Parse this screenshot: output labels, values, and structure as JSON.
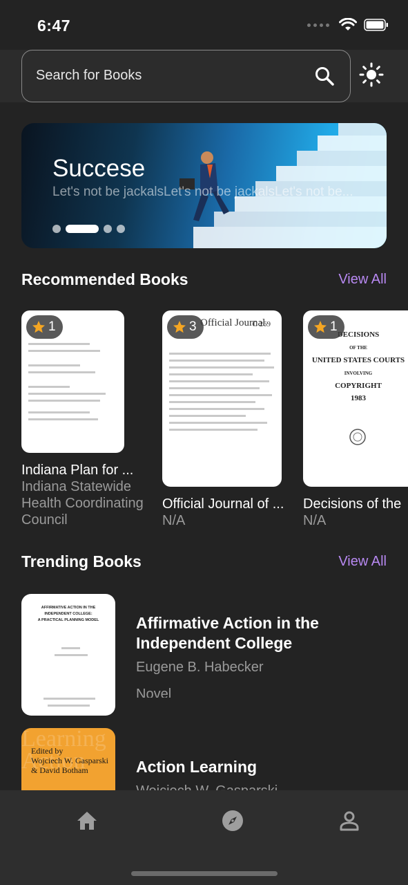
{
  "status_bar": {
    "time": "6:47"
  },
  "search": {
    "placeholder": "Search for Books"
  },
  "banner": {
    "title": "Succese",
    "subtitle": "Let's not be jackalsLet's not be jackalsLet's not be...",
    "pages": 4,
    "active_page": 1
  },
  "recommended": {
    "title": "Recommended Books",
    "view_all": "View All",
    "books": [
      {
        "rating": "1",
        "title": "Indiana Plan for ...",
        "author": "Indiana Statewide Health Coordinating Council"
      },
      {
        "rating": "3",
        "title": "Official Journal of ...",
        "author": "N/A",
        "cover_text": "Official Journal"
      },
      {
        "rating": "1",
        "title": "Decisions of the",
        "author": "N/A",
        "cover_text": "DECISIONS UNITED STATES COURTS COPYRIGHT 1983"
      }
    ]
  },
  "trending": {
    "title": "Trending Books",
    "view_all": "View All",
    "books": [
      {
        "title": "Affirmative Action in the Independent College",
        "author": "Eugene B. Habecker",
        "category": "Novel"
      },
      {
        "title": "Action Learning",
        "author": "Wojciech W. Gasparski",
        "cover_text": "Edited by Wojciech W. Gasparski & David Botham"
      }
    ]
  },
  "nav": {
    "items": [
      "home-icon",
      "explore-icon",
      "profile-icon"
    ]
  },
  "colors": {
    "accent": "#b889f2",
    "background": "#232323",
    "star": "#f5a623"
  }
}
